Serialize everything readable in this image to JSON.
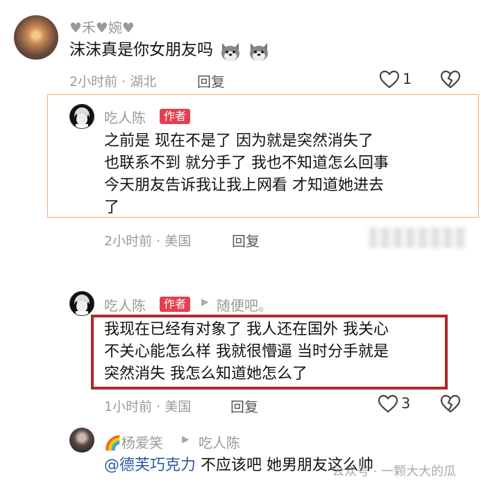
{
  "comments": [
    {
      "username": "♥禾♥婉♥",
      "text": "沫沫真是你女朋友吗",
      "emoji": [
        "husky-emoji",
        "husky-emoji"
      ],
      "time": "2小时前 · 湖北",
      "reply_label": "回复",
      "likes": "1"
    },
    {
      "username": "吃人陈",
      "badge": "作者",
      "text_lines": [
        "之前是 现在不是了 因为就是突然消失了",
        "也联系不到 就分手了 我也不知道怎么回事",
        "今天朋友告诉我让我上网看 才知道她进去",
        "了"
      ],
      "time": "2小时前 · 美国",
      "reply_label": "回复"
    },
    {
      "username": "吃人陈",
      "badge": "作者",
      "reply_to": "随便吧。",
      "text_lines": [
        "我现在已经有对象了 我人还在国外 我关心",
        "不关心能怎么样 我就很懵逼 当时分手就是",
        "突然消失 我怎么知道她怎么了"
      ],
      "time": "1小时前 · 美国",
      "reply_label": "回复",
      "likes": "3"
    },
    {
      "username": "🌈杨爱笑",
      "reply_to": "吃人陈",
      "mention": "@德芙巧克力",
      "text": " 不应该吧 她男朋友这么帅"
    }
  ],
  "watermark": "公众号 · 一颗大大的瓜",
  "colors": {
    "accent_red": "#e5404f",
    "highlight_box": "#b0262a",
    "orange_border": "#f0a878",
    "mention_blue": "#2c5aa0"
  }
}
